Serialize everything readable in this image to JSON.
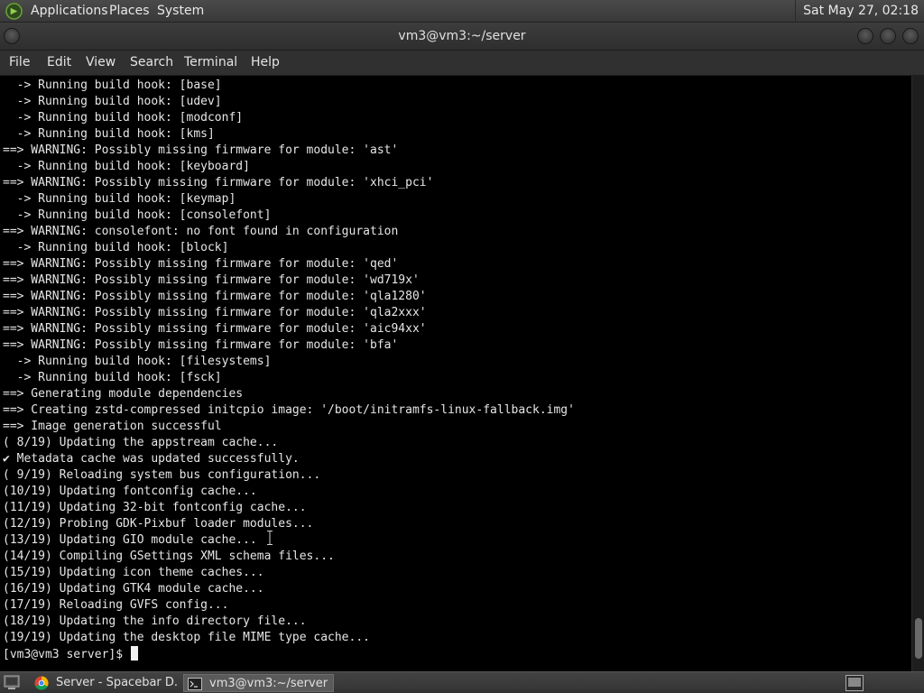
{
  "top_panel": {
    "menus": [
      "Applications",
      "Places",
      "System"
    ],
    "clock": "Sat May 27, 02:18"
  },
  "window": {
    "title": "vm3@vm3:~/server"
  },
  "menubar": {
    "items": [
      "File",
      "Edit",
      "View",
      "Search",
      "Terminal",
      "Help"
    ]
  },
  "terminal": {
    "lines": [
      "  -> Running build hook: [base]",
      "  -> Running build hook: [udev]",
      "  -> Running build hook: [modconf]",
      "  -> Running build hook: [kms]",
      "==> WARNING: Possibly missing firmware for module: 'ast'",
      "  -> Running build hook: [keyboard]",
      "==> WARNING: Possibly missing firmware for module: 'xhci_pci'",
      "  -> Running build hook: [keymap]",
      "  -> Running build hook: [consolefont]",
      "==> WARNING: consolefont: no font found in configuration",
      "  -> Running build hook: [block]",
      "==> WARNING: Possibly missing firmware for module: 'qed'",
      "==> WARNING: Possibly missing firmware for module: 'wd719x'",
      "==> WARNING: Possibly missing firmware for module: 'qla1280'",
      "==> WARNING: Possibly missing firmware for module: 'qla2xxx'",
      "==> WARNING: Possibly missing firmware for module: 'aic94xx'",
      "==> WARNING: Possibly missing firmware for module: 'bfa'",
      "  -> Running build hook: [filesystems]",
      "  -> Running build hook: [fsck]",
      "==> Generating module dependencies",
      "==> Creating zstd-compressed initcpio image: '/boot/initramfs-linux-fallback.img'",
      "==> Image generation successful",
      "( 8/19) Updating the appstream cache...",
      "✔ Metadata cache was updated successfully.",
      "( 9/19) Reloading system bus configuration...",
      "(10/19) Updating fontconfig cache...",
      "(11/19) Updating 32-bit fontconfig cache...",
      "(12/19) Probing GDK-Pixbuf loader modules...",
      "(13/19) Updating GIO module cache...",
      "(14/19) Compiling GSettings XML schema files...",
      "(15/19) Updating icon theme caches...",
      "(16/19) Updating GTK4 module cache...",
      "(17/19) Reloading GVFS config...",
      "(18/19) Updating the info directory file...",
      "(19/19) Updating the desktop file MIME type cache..."
    ],
    "prompt": "[vm3@vm3 server]$ "
  },
  "taskbar": {
    "tasks": [
      {
        "label": "Server - Spacebar D...",
        "icon": "chrome-icon",
        "active": false
      },
      {
        "label": "vm3@vm3:~/server",
        "icon": "terminal-icon",
        "active": true
      }
    ]
  },
  "colors": {
    "terminal_bg": "#000000",
    "terminal_fg": "#e6e6e6",
    "panel_bg": "#3c3c3c"
  }
}
